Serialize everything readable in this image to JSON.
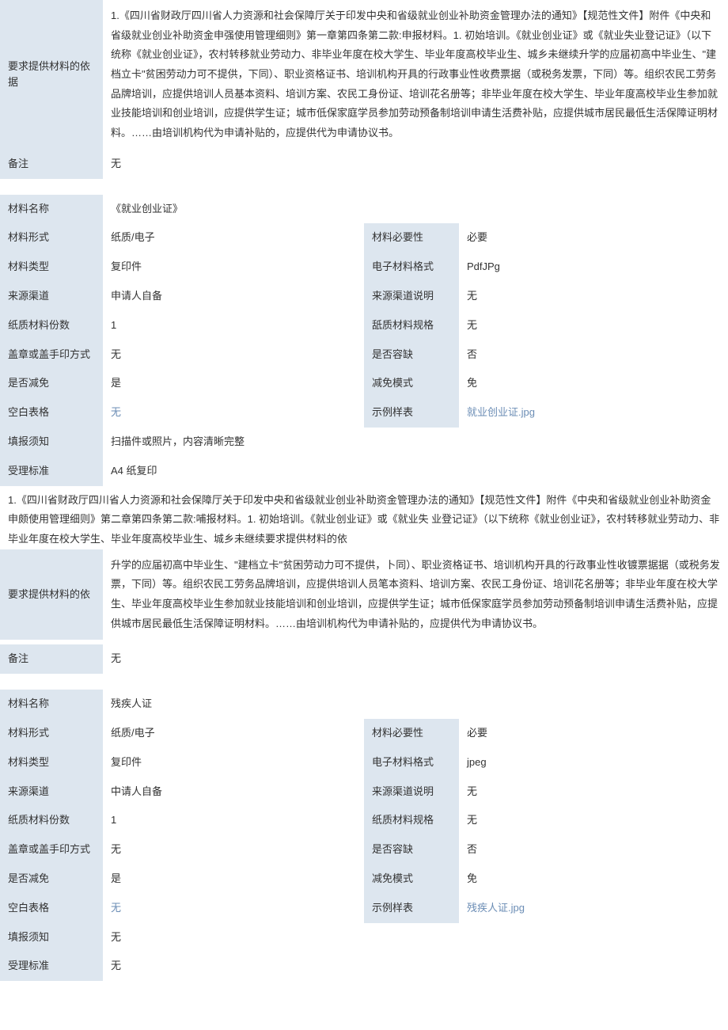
{
  "block1": {
    "basisLabel": "要求提供材料的依据",
    "basisText": "1.《四川省财政厅四川省人力资源和社会保障厅关于印发中央和省级就业创业补助资金管理办法的通知》【规范性文件】附件《中央和省级就业创业补助资金申强使用管理细则》第一章第四条第二款:申报材料。1. 初始培训。《就业创业证》或《就业失业登记证》（以下统称《就业创业证》，农村转移就业劳动力、非毕业年度在校大学生、毕业年度高校毕业生、城乡未继续升学的应届初高中毕业生、\"建档立卡\"贫困劳动力可不提供，下同）、职业资格证书、培训机构开具的行政事业性收费票据（或税务发票，下同）等。组织农民工劳务品牌培训，应提供培训人员基本资料、培训方案、农民工身份证、培训花名册等；非毕业年度在校大学生、毕业年度高校毕业生参加就业技能培训和创业培训，应提供学生证；城市低保家庭学员参加劳动预备制培训申请生活费补贴，应提供城市居民最低生活保障证明材料。……由培训机构代为申请补贴的，应提供代为申请协议书。",
    "remarkLabel": "备注",
    "remarkText": "无"
  },
  "material1": {
    "nameLabel": "材料名称",
    "nameValue": "《就业创业证》",
    "formLabel": "材料形式",
    "formValue": "纸质/电子",
    "necessityLabel": "材料必要性",
    "necessityValue": "必要",
    "typeLabel": "材料类型",
    "typeValue": "复印件",
    "eformatLabel": "电子材料格式",
    "eformatValue": "PdfJPg",
    "sourceLabel": "来源渠道",
    "sourceValue": "申请人自备",
    "sourceDescLabel": "来源渠道说明",
    "sourceDescValue": "无",
    "copiesLabel": "纸质材料份数",
    "copiesValue": "1",
    "specLabel": "舐质材料规格",
    "specValue": "无",
    "stampLabel": "盖章或盖手印方式",
    "stampValue": "无",
    "allowMissingLabel": "是否容缺",
    "allowMissingValue": "否",
    "reduceLabel": "是否减免",
    "reduceValue": "是",
    "reduceModeLabel": "减免模式",
    "reduceModeValue": "免",
    "blankLabel": "空白表格",
    "blankValue": "无",
    "sampleLabel": "示例样表",
    "sampleValue": "就业创业证.jpg",
    "noticeLabel": "填报须知",
    "noticeValue": "扫描件或照片，内容清晰完整",
    "acceptLabel": "受理标准",
    "acceptValue": "A4 纸复印"
  },
  "block2": {
    "line1": "1.《四川省财政厅四川省人力资源和社会保障厅关于印发中央和省级就业创业补助资金管理办法的通知》【规范性文件】附件《中央和省级就业创业补助资金申颇使用管理细则》第二章第四条第二款:哺报材料。1. 初始培训。《就业创业证》或《就业失  业登记证》（以下统称《就业创业证》，农村转移就业劳动力、非毕业年度在校大学生、毕业年度高校毕业生、城乡未继续要求提供材料的依",
    "basisLabel": "要求提供材料的依",
    "line2": "升学的应届初高中毕业生、\"建档立卡\"贫困劳动力可不提供，卜同）、职业资格证书、培训机构开具的行政事业性收镀票据据（或税务发票，下同）等。组织农民工劳务品牌培训，应提供培训人员笔本资料、培训方案、农民工身份证、培训花名册等；非毕业年度在校大学生、毕业年度高校毕业生参加就业技能培训和创业培训，应提供学生证；城市低保家庭学员参加劳动预备制培训申请生活费补贴，应提供城市居民最低生活保障证明材料。……由培训机构代为申请补贴的，应提供代为申请协议书。",
    "remarkLabel": "备注",
    "remarkText": "无"
  },
  "material2": {
    "nameLabel": "材料名称",
    "nameValue": "残疾人证",
    "formLabel": "材料形式",
    "formValue": "纸质/电子",
    "necessityLabel": "材料必要性",
    "necessityValue": "必要",
    "typeLabel": "材料类型",
    "typeValue": "复印件",
    "eformatLabel": "电子材料格式",
    "eformatValue": "jpeg",
    "sourceLabel": "来源渠道",
    "sourceValue": "中请人自备",
    "sourceDescLabel": "来源渠道说明",
    "sourceDescValue": "无",
    "copiesLabel": "纸质材料份数",
    "copiesValue": "1",
    "specLabel": "纸质材料规格",
    "specValue": "无",
    "stampLabel": "盖章或盖手印方式",
    "stampValue": "无",
    "allowMissingLabel": "是否容缺",
    "allowMissingValue": "否",
    "reduceLabel": "是否减免",
    "reduceValue": "是",
    "reduceModeLabel": "减免模式",
    "reduceModeValue": "免",
    "blankLabel": "空白表格",
    "blankValue": "无",
    "sampleLabel": "示例样表",
    "sampleValue": "残疾人证.jpg",
    "noticeLabel": "填报须知",
    "noticeValue": "无",
    "acceptLabel": "受理标准",
    "acceptValue": "无"
  }
}
